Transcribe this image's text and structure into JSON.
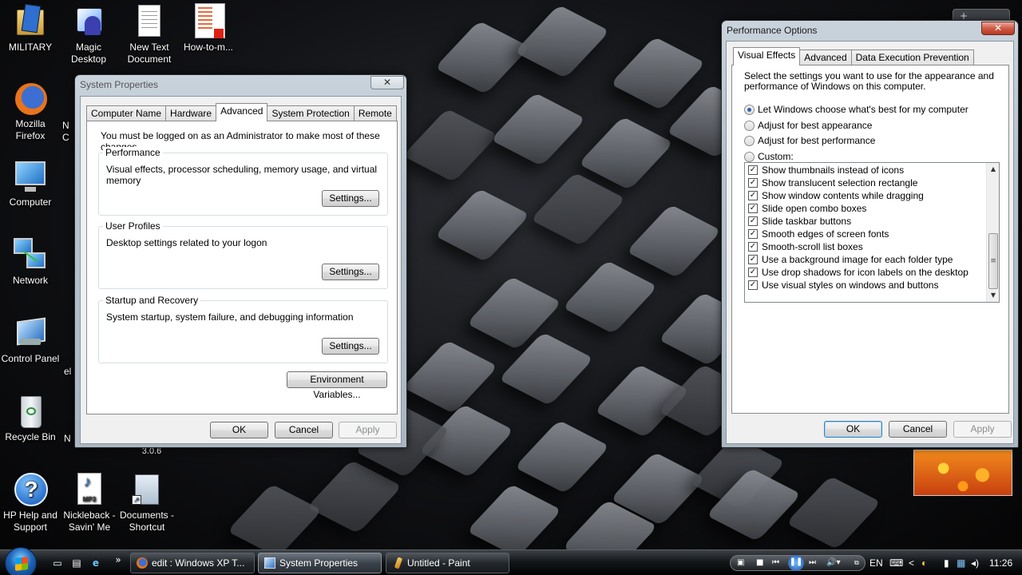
{
  "desktop": {
    "icons": [
      {
        "label": "MILITARY",
        "icon": "folder-icon"
      },
      {
        "label": "Magic Desktop",
        "icon": "magic-desktop-icon"
      },
      {
        "label": "New Text Document",
        "icon": "text-document-icon"
      },
      {
        "label": "How-to-m...",
        "icon": "pdf-icon"
      },
      {
        "label": "Mozilla Firefox",
        "icon": "firefox-icon"
      },
      {
        "label": "Computer",
        "icon": "computer-icon"
      },
      {
        "label": "Network",
        "icon": "network-icon"
      },
      {
        "label": "Control Panel",
        "icon": "control-panel-icon"
      },
      {
        "label": "Recycle Bin",
        "icon": "recycle-bin-icon"
      },
      {
        "label": "HP Help and Support",
        "icon": "help-icon"
      },
      {
        "label": "Nickleback - Savin' Me",
        "icon": "mp3-icon"
      },
      {
        "label": "Documents - Shortcut",
        "icon": "documents-shortcut-icon"
      }
    ],
    "partial_labels": [
      "N",
      "C",
      "el",
      "N",
      "3.0.6"
    ],
    "mp3_badge": "MP3"
  },
  "system_properties": {
    "title": "System Properties",
    "close": "✕",
    "tabs": [
      "Computer Name",
      "Hardware",
      "Advanced",
      "System Protection",
      "Remote"
    ],
    "active_tab": "Advanced",
    "admin_note": "You must be logged on as an Administrator to make most of these changes.",
    "groups": [
      {
        "title": "Performance",
        "description": "Visual effects, processor scheduling, memory usage, and virtual memory",
        "button": "Settings..."
      },
      {
        "title": "User Profiles",
        "description": "Desktop settings related to your logon",
        "button": "Settings..."
      },
      {
        "title": "Startup and Recovery",
        "description": "System startup, system failure, and debugging information",
        "button": "Settings..."
      }
    ],
    "env_button": "Environment Variables...",
    "ok": "OK",
    "cancel": "Cancel",
    "apply": "Apply"
  },
  "performance_options": {
    "title": "Performance Options",
    "close": "✕",
    "tabs": [
      "Visual Effects",
      "Advanced",
      "Data Execution Prevention"
    ],
    "active_tab": "Visual Effects",
    "intro": "Select the settings you want to use for the appearance and performance of Windows on this computer.",
    "radios": [
      {
        "label": "Let Windows choose what's best for my computer",
        "selected": true
      },
      {
        "label": "Adjust for best appearance",
        "selected": false
      },
      {
        "label": "Adjust for best performance",
        "selected": false
      },
      {
        "label": "Custom:",
        "selected": false
      }
    ],
    "effects": [
      {
        "label": "Show thumbnails instead of icons",
        "checked": true
      },
      {
        "label": "Show translucent selection rectangle",
        "checked": true
      },
      {
        "label": "Show window contents while dragging",
        "checked": true
      },
      {
        "label": "Slide open combo boxes",
        "checked": true
      },
      {
        "label": "Slide taskbar buttons",
        "checked": true
      },
      {
        "label": "Smooth edges of screen fonts",
        "checked": true
      },
      {
        "label": "Smooth-scroll list boxes",
        "checked": true
      },
      {
        "label": "Use a background image for each folder type",
        "checked": true
      },
      {
        "label": "Use drop shadows for icon labels on the desktop",
        "checked": true
      },
      {
        "label": "Use visual styles on windows and buttons",
        "checked": true
      }
    ],
    "ok": "OK",
    "cancel": "Cancel",
    "apply": "Apply"
  },
  "taskbar": {
    "quick_launch": [
      "show-desktop-icon",
      "switch-windows-icon",
      "internet-explorer-icon"
    ],
    "overflow": "»",
    "tasks": [
      {
        "label": "edit : Windows XP T...",
        "icon": "firefox-icon",
        "active": false
      },
      {
        "label": "System Properties",
        "icon": "system-properties-icon",
        "active": true
      },
      {
        "label": "Untitled - Paint",
        "icon": "paint-icon",
        "active": false
      }
    ],
    "language": "EN",
    "clock": "11:26",
    "tray_chevron": "<"
  },
  "sidebar_widget": {
    "plus": "+"
  },
  "colors": {
    "accent": "#3c7fb1",
    "close_red": "#cf5b45",
    "taskbar": "#14171a"
  }
}
